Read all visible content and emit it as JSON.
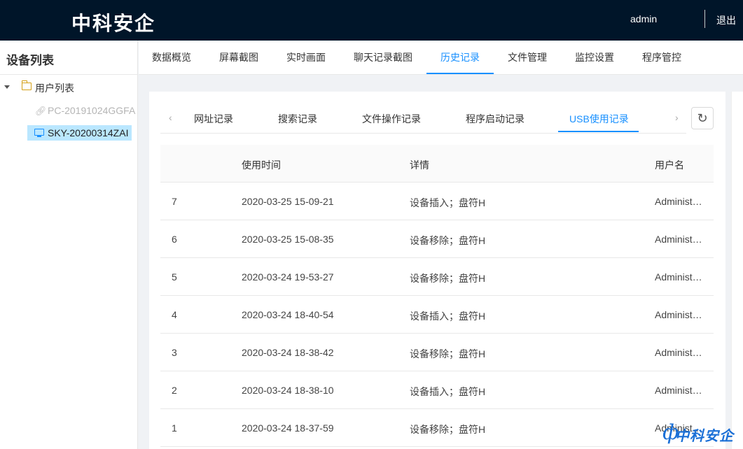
{
  "header": {
    "brand": "中科安企",
    "user": "admin",
    "logout": "退出"
  },
  "sidebar": {
    "title": "设备列表",
    "root_label": "用户列表",
    "devices": [
      {
        "label": "PC-20191024GGFA",
        "icon": "link-icon",
        "state": "offline"
      },
      {
        "label": "SKY-20200314ZAI",
        "icon": "monitor-icon",
        "state": "selected"
      }
    ]
  },
  "main_tabs": [
    {
      "label": "数据概览"
    },
    {
      "label": "屏幕截图"
    },
    {
      "label": "实时画面"
    },
    {
      "label": "聊天记录截图"
    },
    {
      "label": "历史记录",
      "active": true
    },
    {
      "label": "文件管理"
    },
    {
      "label": "监控设置"
    },
    {
      "label": "程序管控"
    }
  ],
  "sub_tabs": [
    {
      "label": "网址记录"
    },
    {
      "label": "搜索记录"
    },
    {
      "label": "文件操作记录"
    },
    {
      "label": "程序启动记录"
    },
    {
      "label": "USB使用记录",
      "active": true
    }
  ],
  "nav_arrows": {
    "prev": "‹",
    "next": "›"
  },
  "refresh_icon": "↻",
  "table": {
    "columns": [
      "",
      "使用时间",
      "详情",
      "用户名"
    ],
    "rows": [
      {
        "id": "7",
        "time": "2020-03-25 15-09-21",
        "detail": "设备插入；盘符H",
        "user": "Administ…"
      },
      {
        "id": "6",
        "time": "2020-03-25 15-08-35",
        "detail": "设备移除；盘符H",
        "user": "Administ…"
      },
      {
        "id": "5",
        "time": "2020-03-24 19-53-27",
        "detail": "设备移除；盘符H",
        "user": "Administ…"
      },
      {
        "id": "4",
        "time": "2020-03-24 18-40-54",
        "detail": "设备插入；盘符H",
        "user": "Administ…"
      },
      {
        "id": "3",
        "time": "2020-03-24 18-38-42",
        "detail": "设备移除；盘符H",
        "user": "Administ…"
      },
      {
        "id": "2",
        "time": "2020-03-24 18-38-10",
        "detail": "设备插入；盘符H",
        "user": "Administ…"
      },
      {
        "id": "1",
        "time": "2020-03-24 18-37-59",
        "detail": "设备移除；盘符H",
        "user": "Administ…"
      }
    ]
  },
  "watermark": {
    "mark": "ф",
    "text": "中科安企"
  },
  "colors": {
    "header_bg": "#001529",
    "accent": "#1890ff",
    "selected_bg": "#bae7ff",
    "folder": "#d4a017"
  }
}
